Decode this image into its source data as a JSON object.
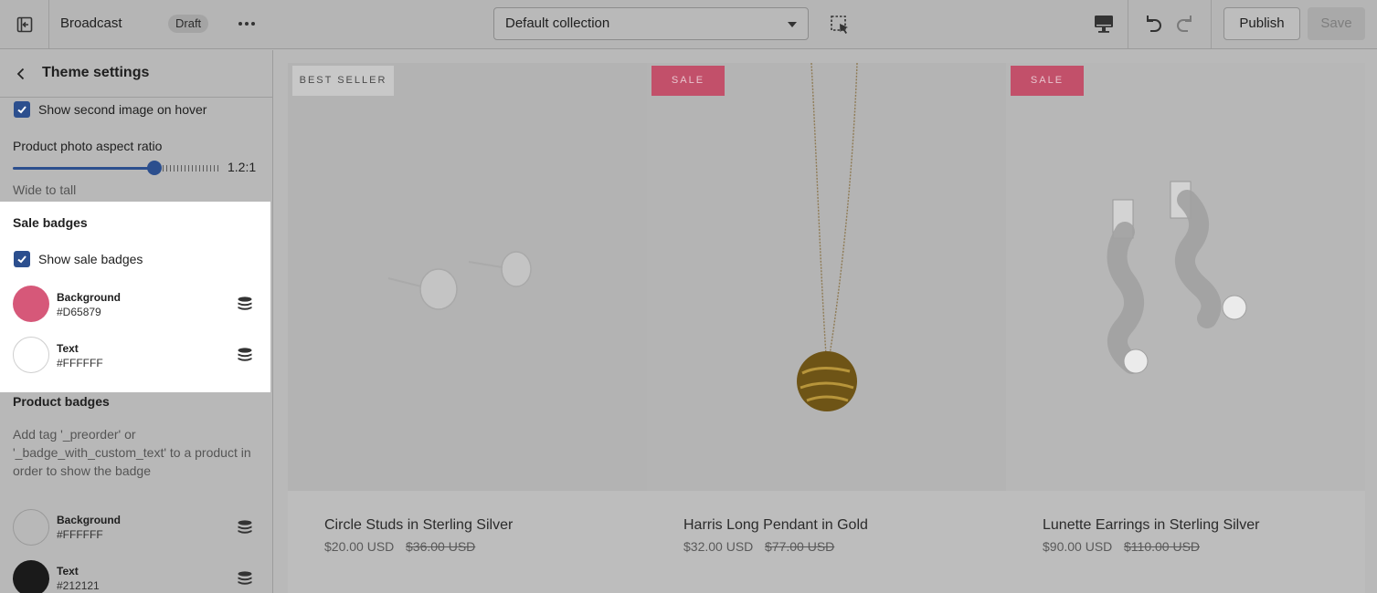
{
  "topbar": {
    "theme_name": "Broadcast",
    "status_badge": "Draft",
    "collection_select": "Default collection",
    "publish_label": "Publish",
    "save_label": "Save"
  },
  "sidebar": {
    "title": "Theme settings",
    "show_second_image": {
      "label": "Show second image on hover",
      "checked": true
    },
    "aspect_ratio": {
      "label": "Product photo aspect ratio",
      "value": "1.2:1",
      "hint": "Wide to tall"
    },
    "sale_badges": {
      "title": "Sale badges",
      "show_label": "Show sale badges",
      "show_checked": true,
      "colors": [
        {
          "name": "Background",
          "hex": "#D65879"
        },
        {
          "name": "Text",
          "hex": "#FFFFFF"
        }
      ]
    },
    "product_badges": {
      "title": "Product badges",
      "hint": "Add tag '_preorder' or '_badge_with_custom_text' to a product in order to show the badge",
      "colors": [
        {
          "name": "Background",
          "hex": "#FFFFFF"
        },
        {
          "name": "Text",
          "hex": "#212121"
        }
      ]
    }
  },
  "preview": {
    "products": [
      {
        "badge": "BEST SELLER",
        "title": "Circle Studs in Sterling Silver",
        "price": "$20.00 USD",
        "compare_price": "$36.00 USD"
      },
      {
        "badge": "SALE",
        "title": "Harris Long Pendant in Gold",
        "price": "$32.00 USD",
        "compare_price": "$77.00 USD"
      },
      {
        "badge": "SALE",
        "title": "Lunette Earrings in Sterling Silver",
        "price": "$90.00 USD",
        "compare_price": "$110.00 USD"
      }
    ]
  },
  "colors": {
    "accent": "#2C4F8E",
    "sale_badge": "#D65879"
  }
}
